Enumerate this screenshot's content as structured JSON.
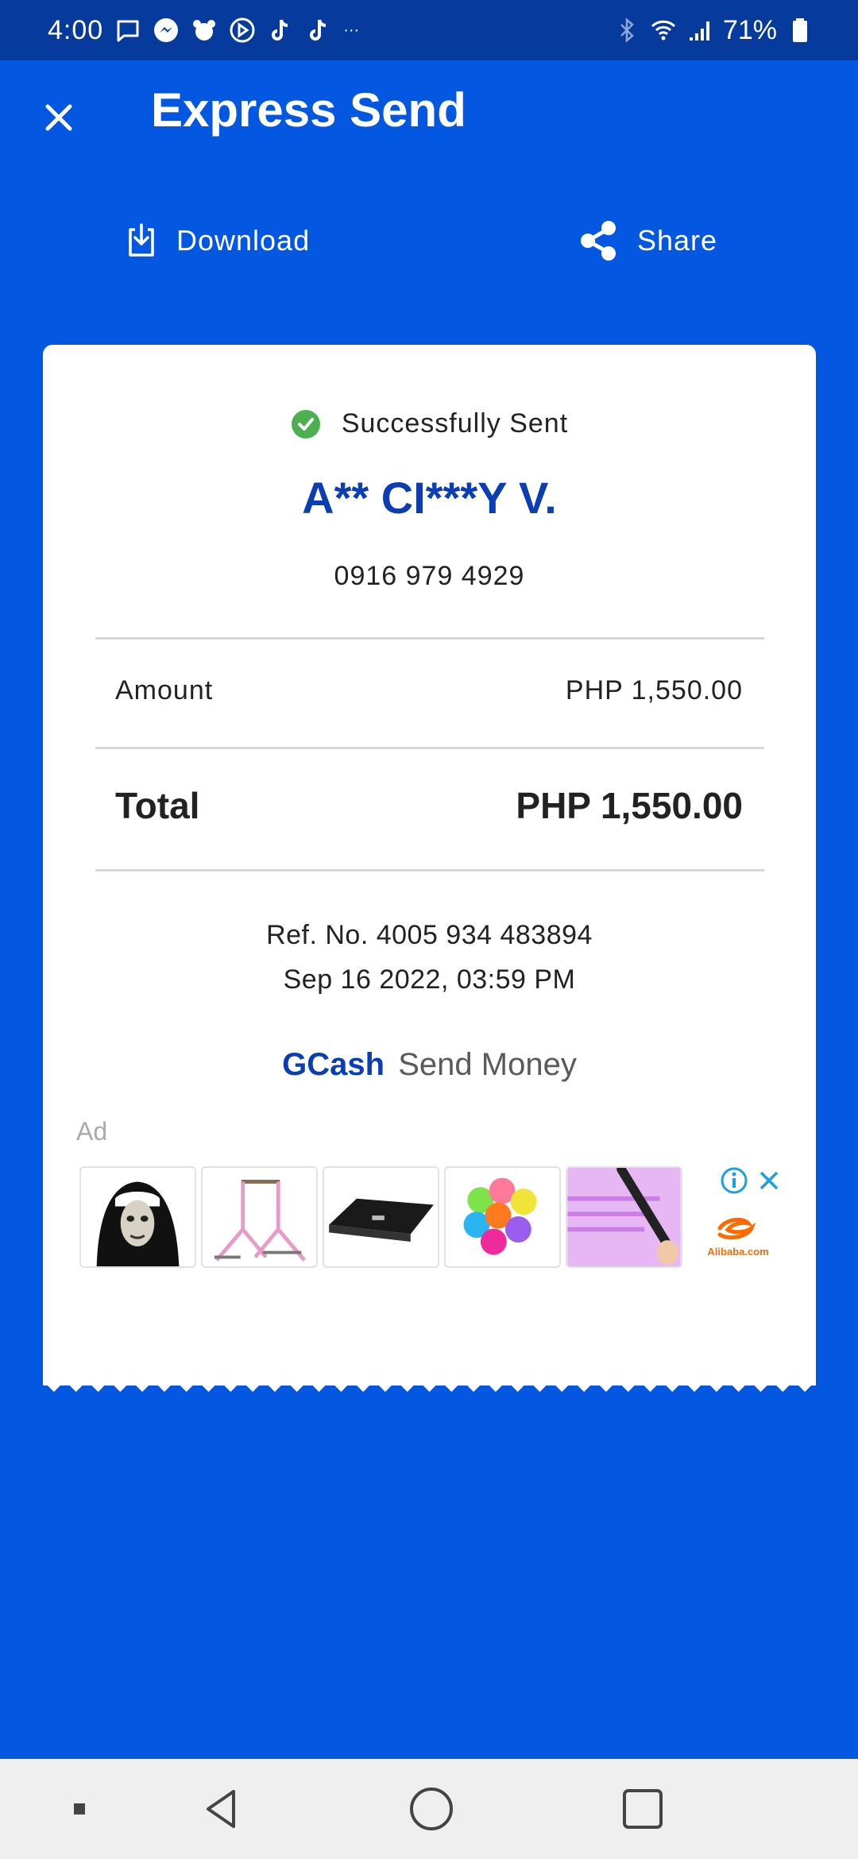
{
  "status_bar": {
    "time": "4:00",
    "battery_percent": "71%",
    "left_icons": [
      "message-icon",
      "messenger-icon",
      "pet-icon",
      "play-icon",
      "tiktok-icon",
      "tiktok-icon",
      "more-icon"
    ],
    "right_icons": [
      "bluetooth-icon",
      "wifi-icon",
      "signal-icon",
      "battery-icon"
    ],
    "more_dots": "···"
  },
  "header": {
    "title": "Express Send",
    "close_icon": "close-icon"
  },
  "actions": {
    "download_label": "Download",
    "share_label": "Share"
  },
  "receipt": {
    "status": "Successfully Sent",
    "recipient": "A** CI***Y V.",
    "phone": "0916 979 4929",
    "amount_label": "Amount",
    "amount_value": "PHP 1,550.00",
    "total_label": "Total",
    "total_value": "PHP 1,550.00",
    "ref_no": "Ref. No. 4005 934 483894",
    "datetime": "Sep 16 2022, 03:59 PM",
    "brand_name": "GCash",
    "brand_product": "Send Money"
  },
  "ad": {
    "label": "Ad",
    "brand_text": "Alibaba.com",
    "products": [
      "nun-mask",
      "gymnastics-bar",
      "black-device",
      "colored-balls",
      "uv-wand"
    ]
  },
  "colors": {
    "primary_blue": "#0357e0",
    "status_bar": "#063a9c",
    "brand_text_blue": "#0b3db5",
    "success_green": "#4caf50"
  },
  "nav_bar": {
    "items": [
      "recent-dot-icon",
      "back-icon",
      "home-icon",
      "overview-icon"
    ]
  }
}
